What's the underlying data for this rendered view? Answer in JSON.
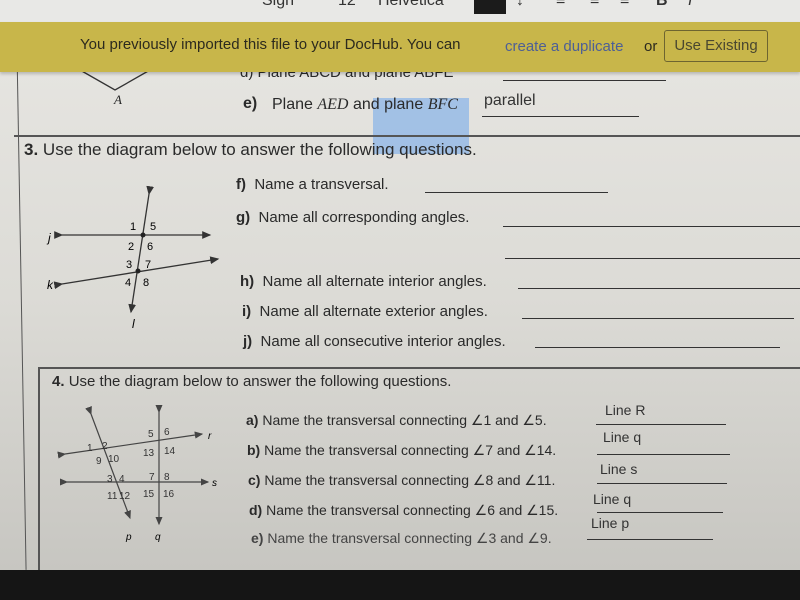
{
  "toolbar": {
    "sign": "Sign",
    "font_size": "12",
    "font": "Helvetica",
    "bold": "B",
    "italic": "I",
    "text_color": "#1b1b1b"
  },
  "banner": {
    "message": "You previously imported this file to your DocHub. You can",
    "link": "create a duplicate",
    "or": "or",
    "button": "Use Existing",
    "color": "#c8b64a"
  },
  "prev": {
    "vertex": "A",
    "d_text": "d) Plane ABCD and plane ABFE",
    "e_label": "e)",
    "e_text_1": "Plane",
    "e_italic_1": "AED",
    "e_text_2": "and plane",
    "e_italic_2": "BFC",
    "e_answer": "parallel"
  },
  "q3": {
    "number": "3.",
    "title": "Use the diagram below to answer the following questions.",
    "diagram": {
      "lines": [
        "j",
        "k",
        "l"
      ],
      "angles": [
        "1",
        "5",
        "2",
        "6",
        "3",
        "7",
        "4",
        "8"
      ]
    },
    "items": [
      {
        "label": "f)",
        "text": "Name a transversal."
      },
      {
        "label": "g)",
        "text": "Name all corresponding angles."
      },
      {
        "label": "h)",
        "text": "Name all alternate interior angles."
      },
      {
        "label": "i)",
        "text": "Name all alternate exterior angles."
      },
      {
        "label": "j)",
        "text": "Name all consecutive interior angles."
      }
    ]
  },
  "q4": {
    "number": "4.",
    "title": "Use the diagram below to answer the following questions.",
    "diagram": {
      "lines": [
        "r",
        "s",
        "p",
        "q"
      ],
      "angles": [
        "1",
        "2",
        "9",
        "10",
        "3",
        "4",
        "11",
        "12",
        "5",
        "6",
        "13",
        "14",
        "7",
        "8",
        "15",
        "16"
      ]
    },
    "items": [
      {
        "label": "a)",
        "text": "Name the transversal connecting ∠1 and ∠5.",
        "answer": "Line R"
      },
      {
        "label": "b)",
        "text": "Name the transversal connecting ∠7 and ∠14.",
        "answer": "Line q"
      },
      {
        "label": "c)",
        "text": "Name the transversal connecting ∠8 and ∠11.",
        "answer": "Line s"
      },
      {
        "label": "d)",
        "text": "Name the transversal connecting ∠6 and ∠15.",
        "answer": "Line q"
      },
      {
        "label": "e)",
        "text": "Name the transversal connecting ∠3 and ∠9.",
        "answer": "Line p"
      }
    ]
  }
}
